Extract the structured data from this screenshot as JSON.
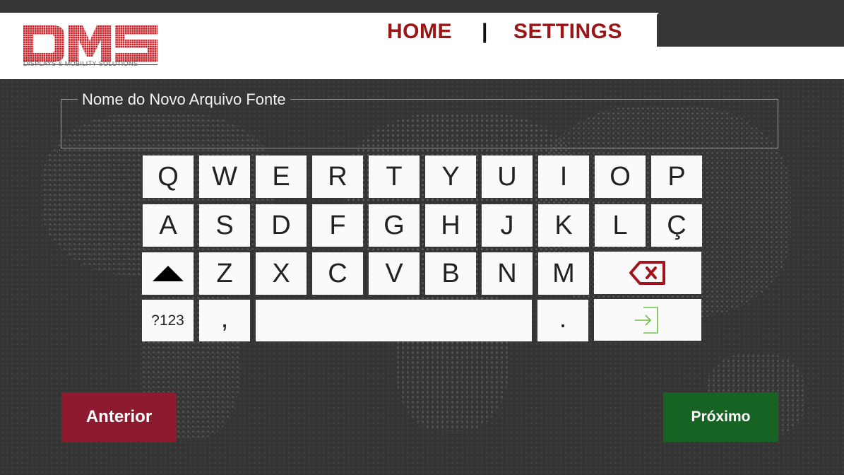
{
  "brand": {
    "logo_letters": "DMS",
    "tagline": "DISPLAYS & MOBILITY SOLUTIONS",
    "color": "#c8151b"
  },
  "nav": {
    "home": "HOME",
    "separator": "|",
    "settings": "SETTINGS",
    "color": "#9b1416"
  },
  "input": {
    "label": "Nome do  Novo Arquivo Fonte",
    "value": ""
  },
  "keyboard": {
    "row1": [
      "Q",
      "W",
      "E",
      "R",
      "T",
      "Y",
      "U",
      "I",
      "O",
      "P"
    ],
    "row2": [
      "A",
      "S",
      "D",
      "F",
      "G",
      "H",
      "J",
      "K",
      "L",
      "Ç"
    ],
    "row3": [
      "Z",
      "X",
      "C",
      "V",
      "B",
      "N",
      "M"
    ],
    "shift_icon": "shift-triangle-icon",
    "backspace_icon": "backspace-icon",
    "symbols_label": "?123",
    "comma": ",",
    "period": ".",
    "enter_icon": "enter-arrow-icon",
    "backspace_color": "#a3131c",
    "enter_color": "#6cc04a"
  },
  "buttons": {
    "previous": "Anterior",
    "next": "Próximo"
  }
}
